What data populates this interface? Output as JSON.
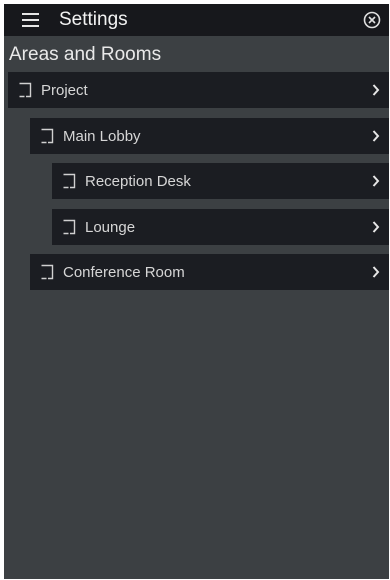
{
  "header": {
    "title": "Settings",
    "menu_icon": "hamburger-menu-icon",
    "close_icon": "close-circle-icon"
  },
  "section": {
    "title": "Areas and Rooms"
  },
  "tree": {
    "items": [
      {
        "label": "Project",
        "level": 0,
        "icon": "room-icon",
        "chevron": "chevron-right-icon"
      },
      {
        "label": "Main Lobby",
        "level": 1,
        "icon": "room-icon",
        "chevron": "chevron-right-icon"
      },
      {
        "label": "Reception Desk",
        "level": 2,
        "icon": "room-icon",
        "chevron": "chevron-right-icon"
      },
      {
        "label": "Lounge",
        "level": 2,
        "icon": "room-icon",
        "chevron": "chevron-right-icon"
      },
      {
        "label": "Conference Room",
        "level": 1,
        "icon": "room-icon",
        "chevron": "chevron-right-icon"
      }
    ]
  },
  "colors": {
    "background": "#3c4043",
    "topbar": "#17181c",
    "row": "#1b1d22",
    "text": "#d6d6d6"
  }
}
